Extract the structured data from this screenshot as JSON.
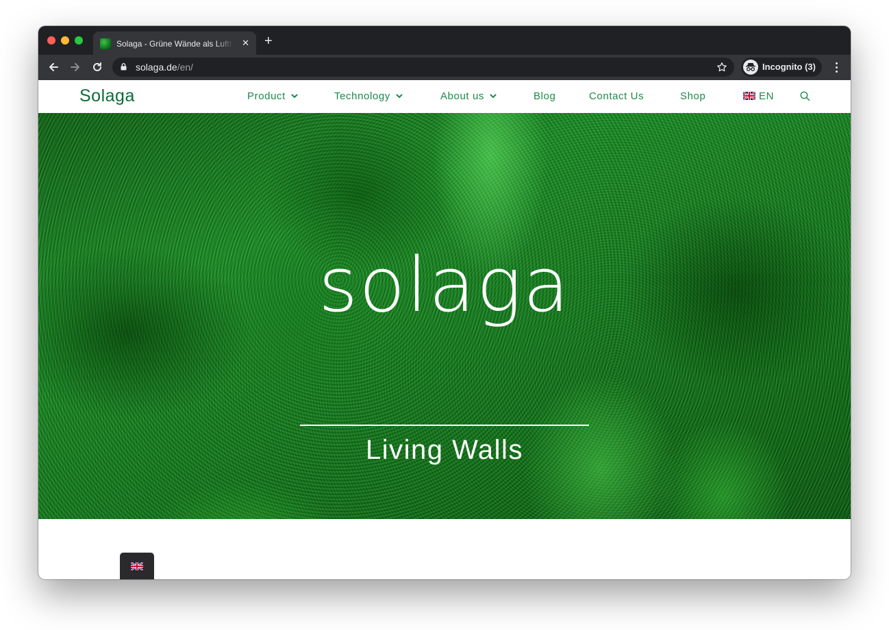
{
  "browser": {
    "tab_title": "Solaga - Grüne Wände als Luftfilter",
    "url_host": "solaga.de",
    "url_path": "/en/",
    "profile_label": "Incognito (3)"
  },
  "site": {
    "logo": "Solaga",
    "nav": [
      {
        "label": "Product",
        "has_dropdown": true
      },
      {
        "label": "Technology",
        "has_dropdown": true
      },
      {
        "label": "About us",
        "has_dropdown": true
      },
      {
        "label": "Blog",
        "has_dropdown": false
      },
      {
        "label": "Contact Us",
        "has_dropdown": false
      },
      {
        "label": "Shop",
        "has_dropdown": false
      }
    ],
    "language": "EN",
    "accent_color": "#1a8a4a"
  },
  "hero": {
    "wordmark": "solaga",
    "tagline": "Living Walls"
  },
  "icons": [
    "back-icon",
    "forward-icon",
    "reload-icon",
    "lock-icon",
    "bookmark-star-icon",
    "incognito-icon",
    "menu-icon",
    "search-icon",
    "uk-flag-icon"
  ]
}
